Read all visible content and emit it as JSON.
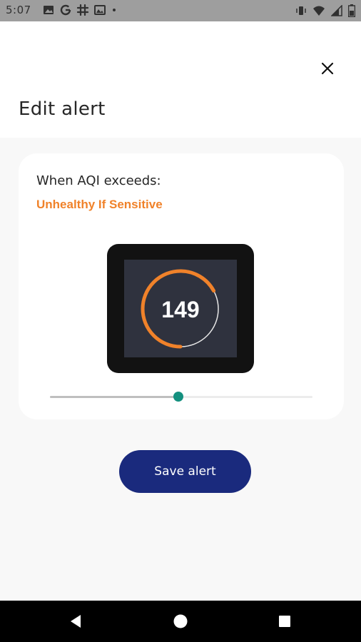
{
  "status_bar": {
    "time": "5:07",
    "left_icons": [
      "image-icon",
      "google-icon",
      "slack-icon",
      "photo-icon",
      "dot-icon"
    ],
    "right_icons": [
      "vibrate-icon",
      "wifi-icon",
      "signal-icon",
      "battery-icon"
    ]
  },
  "header": {
    "title": "Edit alert",
    "close_icon": "close-icon"
  },
  "alert_card": {
    "label": "When AQI exceeds:",
    "level": "Unhealthy If Sensitive",
    "gauge": {
      "value": "149",
      "progress": 0.67
    },
    "slider": {
      "value_fraction": 0.49
    }
  },
  "actions": {
    "save_label": "Save alert"
  },
  "colors": {
    "accent_orange": "#f0822a",
    "slider_thumb": "#14907f",
    "primary_button": "#1a2a7d",
    "device_bezel": "#121212",
    "device_screen": "#2f323e"
  },
  "nav_bar": {
    "icons": [
      "back-icon",
      "home-icon",
      "recents-icon"
    ]
  }
}
